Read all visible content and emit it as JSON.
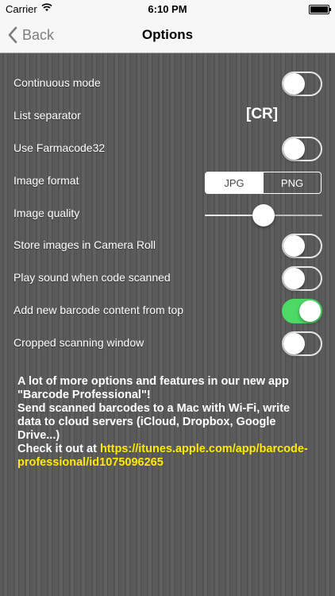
{
  "statusbar": {
    "carrier": "Carrier",
    "time": "6:10 PM"
  },
  "navbar": {
    "back_label": "Back",
    "title": "Options"
  },
  "settings": {
    "continuous_mode": {
      "label": "Continuous mode",
      "on": false
    },
    "list_separator": {
      "label": "List separator",
      "value": "[CR]"
    },
    "use_farmacode32": {
      "label": "Use Farmacode32",
      "on": false
    },
    "image_format": {
      "label": "Image format",
      "options": [
        "JPG",
        "PNG"
      ],
      "selected": "JPG"
    },
    "image_quality": {
      "label": "Image quality",
      "value": 0.5
    },
    "store_images": {
      "label": "Store images in Camera Roll",
      "on": false
    },
    "play_sound": {
      "label": "Play sound when code scanned",
      "on": false
    },
    "add_from_top": {
      "label": "Add new barcode content from top",
      "on": true
    },
    "cropped_window": {
      "label": "Cropped scanning window",
      "on": false
    }
  },
  "promo": {
    "text": "A lot of more options and features in our new app \"Barcode Professional\"!\nSend scanned barcodes to a Mac with Wi-Fi, write data to cloud servers (iCloud, Dropbox, Google Drive...)\nCheck it out at ",
    "link": "https://itunes.apple.com/app/barcode-professional/id1075096265"
  },
  "colors": {
    "switch_on": "#4cd964",
    "link": "#ffea00",
    "nav_bg": "#f7f7f7"
  }
}
